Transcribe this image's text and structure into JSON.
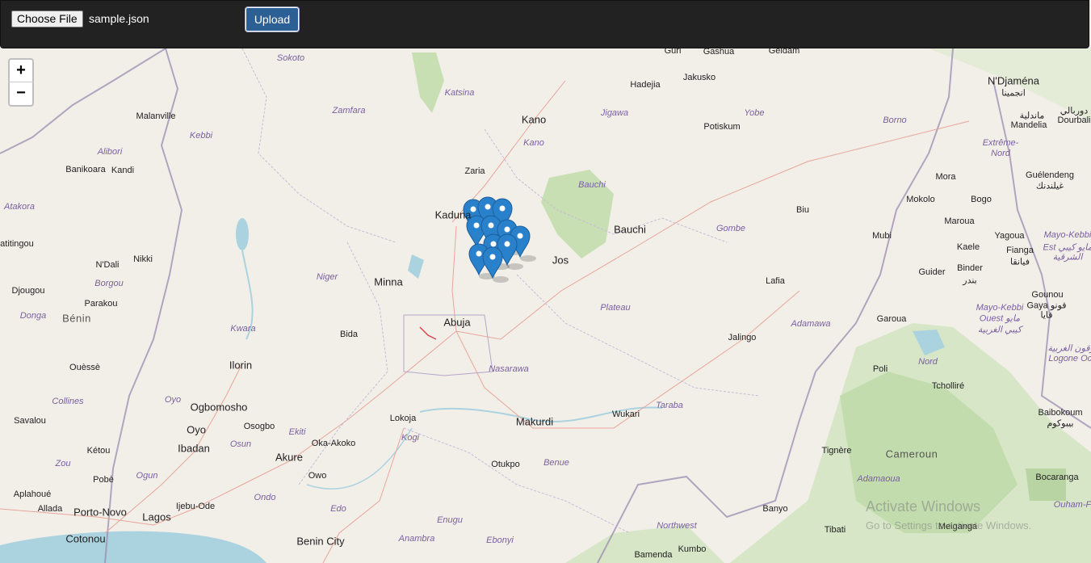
{
  "toolbar": {
    "choose_file_label": "Choose File",
    "file_name": "sample.json",
    "upload_label": "Upload"
  },
  "map": {
    "zoom_in_label": "+",
    "zoom_out_label": "−",
    "marker_count": 11,
    "watermark": {
      "title": "Activate Windows",
      "subtitle": "Go to Settings to activate Windows."
    },
    "labels": [
      {
        "text": "Sokoto",
        "kind": "region"
      },
      {
        "text": "Zamfara",
        "kind": "region"
      },
      {
        "text": "Katsina",
        "kind": "region"
      },
      {
        "text": "Kano",
        "kind": "bigcity"
      },
      {
        "text": "Kano",
        "kind": "region"
      },
      {
        "text": "Jigawa",
        "kind": "region"
      },
      {
        "text": "Hadejia",
        "kind": "city"
      },
      {
        "text": "Jakusko",
        "kind": "city"
      },
      {
        "text": "Guri",
        "kind": "city"
      },
      {
        "text": "Gashua",
        "kind": "city"
      },
      {
        "text": "Geidam",
        "kind": "city"
      },
      {
        "text": "Yobe",
        "kind": "region"
      },
      {
        "text": "Potiskum",
        "kind": "city"
      },
      {
        "text": "Borno",
        "kind": "region"
      },
      {
        "text": "N'Djaména",
        "kind": "bigcity"
      },
      {
        "text": "انجمينا",
        "kind": "city"
      },
      {
        "text": "دوربالي",
        "kind": "city"
      },
      {
        "text": "Dourbali",
        "kind": "city"
      },
      {
        "text": "ماندلية",
        "kind": "city"
      },
      {
        "text": "Mandelia",
        "kind": "city"
      },
      {
        "text": "Extrême-",
        "kind": "region"
      },
      {
        "text": "Nord",
        "kind": "region"
      },
      {
        "text": "Malanville",
        "kind": "city"
      },
      {
        "text": "Kebbi",
        "kind": "region"
      },
      {
        "text": "Alibori",
        "kind": "region"
      },
      {
        "text": "Banikoara",
        "kind": "city"
      },
      {
        "text": "Kandi",
        "kind": "city"
      },
      {
        "text": "Zaria",
        "kind": "city"
      },
      {
        "text": "Bauchi",
        "kind": "region"
      },
      {
        "text": "Kaduna",
        "kind": "bigcity"
      },
      {
        "text": "Bauchi",
        "kind": "bigcity"
      },
      {
        "text": "Gombe",
        "kind": "region"
      },
      {
        "text": "Biu",
        "kind": "city"
      },
      {
        "text": "Mokolo",
        "kind": "city"
      },
      {
        "text": "Mora",
        "kind": "city"
      },
      {
        "text": "Bogo",
        "kind": "city"
      },
      {
        "text": "Guélendeng",
        "kind": "city"
      },
      {
        "text": "غيلندنك",
        "kind": "city"
      },
      {
        "text": "Atakora",
        "kind": "region"
      },
      {
        "text": "Natitingou",
        "kind": "city"
      },
      {
        "text": "N'Dali",
        "kind": "city"
      },
      {
        "text": "Nikki",
        "kind": "city"
      },
      {
        "text": "Borgou",
        "kind": "region"
      },
      {
        "text": "Djougou",
        "kind": "city"
      },
      {
        "text": "Niger",
        "kind": "region"
      },
      {
        "text": "Minna",
        "kind": "bigcity"
      },
      {
        "text": "Jos",
        "kind": "bigcity"
      },
      {
        "text": "Mubi",
        "kind": "city"
      },
      {
        "text": "Maroua",
        "kind": "city"
      },
      {
        "text": "Yagoua",
        "kind": "city"
      },
      {
        "text": "Mayo-Kebbi",
        "kind": "region"
      },
      {
        "text": "Est مايو كيبي",
        "kind": "region"
      },
      {
        "text": "الشرقية",
        "kind": "region"
      },
      {
        "text": "Kaele",
        "kind": "city"
      },
      {
        "text": "Fianga",
        "kind": "city"
      },
      {
        "text": "فيانقا",
        "kind": "city"
      },
      {
        "text": "Guider",
        "kind": "city"
      },
      {
        "text": "Binder",
        "kind": "city"
      },
      {
        "text": "بندر",
        "kind": "city"
      },
      {
        "text": "Parakou",
        "kind": "city"
      },
      {
        "text": "Lafia",
        "kind": "city"
      },
      {
        "text": "Plateau",
        "kind": "region"
      },
      {
        "text": "Gounou",
        "kind": "city"
      },
      {
        "text": "Gaya قونو",
        "kind": "city"
      },
      {
        "text": "قايا",
        "kind": "city"
      },
      {
        "text": "Donga",
        "kind": "region"
      },
      {
        "text": "Bénin",
        "kind": "country"
      },
      {
        "text": "Abuja",
        "kind": "bigcity"
      },
      {
        "text": "Adamawa",
        "kind": "region"
      },
      {
        "text": "Garoua",
        "kind": "city"
      },
      {
        "text": "Mayo-Kebbi",
        "kind": "region"
      },
      {
        "text": "Ouest مايو",
        "kind": "region"
      },
      {
        "text": "كيبي الغربية",
        "kind": "region"
      },
      {
        "text": "Kwara",
        "kind": "region"
      },
      {
        "text": "Bida",
        "kind": "city"
      },
      {
        "text": "Jalingo",
        "kind": "city"
      },
      {
        "text": "Nord",
        "kind": "region"
      },
      {
        "text": "لوقون الغربية",
        "kind": "region"
      },
      {
        "text": "Logone Occ",
        "kind": "region"
      },
      {
        "text": "Ilorin",
        "kind": "bigcity"
      },
      {
        "text": "Ouèssè",
        "kind": "city"
      },
      {
        "text": "Nasarawa",
        "kind": "region"
      },
      {
        "text": "Poli",
        "kind": "city"
      },
      {
        "text": "Tcholliré",
        "kind": "city"
      },
      {
        "text": "Collines",
        "kind": "region"
      },
      {
        "text": "Oyo",
        "kind": "region"
      },
      {
        "text": "Ogbomosho",
        "kind": "bigcity"
      },
      {
        "text": "Taraba",
        "kind": "region"
      },
      {
        "text": "Wukari",
        "kind": "city"
      },
      {
        "text": "Baibokoum",
        "kind": "city"
      },
      {
        "text": "بيبوكوم",
        "kind": "city"
      },
      {
        "text": "Savalou",
        "kind": "city"
      },
      {
        "text": "Oyo",
        "kind": "bigcity"
      },
      {
        "text": "Osogbo",
        "kind": "city"
      },
      {
        "text": "Lokoja",
        "kind": "city"
      },
      {
        "text": "Makurdi",
        "kind": "bigcity"
      },
      {
        "text": "Ekiti",
        "kind": "region"
      },
      {
        "text": "Kogi",
        "kind": "region"
      },
      {
        "text": "Ibadan",
        "kind": "bigcity"
      },
      {
        "text": "Osun",
        "kind": "region"
      },
      {
        "text": "Oka-Akoko",
        "kind": "city"
      },
      {
        "text": "Kétou",
        "kind": "city"
      },
      {
        "text": "Tignère",
        "kind": "city"
      },
      {
        "text": "Cameroun",
        "kind": "country"
      },
      {
        "text": "Akure",
        "kind": "bigcity"
      },
      {
        "text": "Zou",
        "kind": "region"
      },
      {
        "text": "Benue",
        "kind": "region"
      },
      {
        "text": "Otukpo",
        "kind": "city"
      },
      {
        "text": "Pobè",
        "kind": "city"
      },
      {
        "text": "Ogun",
        "kind": "region"
      },
      {
        "text": "Owo",
        "kind": "city"
      },
      {
        "text": "Adamaoua",
        "kind": "region"
      },
      {
        "text": "Bocaranga",
        "kind": "city"
      },
      {
        "text": "Aplahoué",
        "kind": "city"
      },
      {
        "text": "Ondo",
        "kind": "region"
      },
      {
        "text": "Ijebu-Ode",
        "kind": "city"
      },
      {
        "text": "Ouham-F",
        "kind": "region"
      },
      {
        "text": "Allada",
        "kind": "city"
      },
      {
        "text": "Porto-Novo",
        "kind": "bigcity"
      },
      {
        "text": "Lagos",
        "kind": "bigcity"
      },
      {
        "text": "Edo",
        "kind": "region"
      },
      {
        "text": "Enugu",
        "kind": "region"
      },
      {
        "text": "Banyo",
        "kind": "city"
      },
      {
        "text": "Northwest",
        "kind": "region"
      },
      {
        "text": "Tibati",
        "kind": "city"
      },
      {
        "text": "Meiganga",
        "kind": "city"
      },
      {
        "text": "Cotonou",
        "kind": "bigcity"
      },
      {
        "text": "Benin City",
        "kind": "bigcity"
      },
      {
        "text": "Anambra",
        "kind": "region"
      },
      {
        "text": "Ebonyi",
        "kind": "region"
      },
      {
        "text": "Kumbo",
        "kind": "city"
      },
      {
        "text": "Bamenda",
        "kind": "city"
      }
    ]
  }
}
